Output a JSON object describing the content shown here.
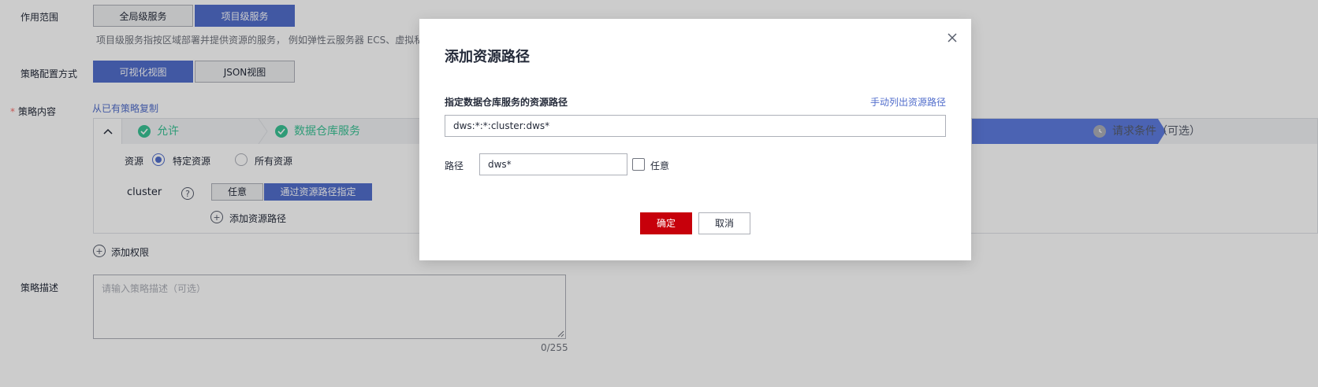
{
  "scope": {
    "label": "作用范围",
    "options": [
      "全局级服务",
      "项目级服务"
    ],
    "selected_index": 1,
    "hint": "项目级服务指按区域部署并提供资源的服务， 例如弹性云服务器 ECS、虚拟私"
  },
  "config_mode": {
    "label": "策略配置方式",
    "options": [
      "可视化视图",
      "JSON视图"
    ],
    "selected_index": 0
  },
  "policy_content": {
    "required_mark": "*",
    "label": "策略内容",
    "copy_link": "从已有策略复制",
    "steps": [
      {
        "label": "允许",
        "state": "done"
      },
      {
        "label": "数据仓库服务",
        "state": "done"
      },
      {
        "label": "请求条件（可选）",
        "state": "todo"
      }
    ],
    "resource": {
      "label": "资源",
      "options": [
        "特定资源",
        "所有资源"
      ],
      "selected_index": 0
    },
    "cluster": {
      "label": "cluster",
      "help_icon": "question-circle-icon",
      "options": [
        "任意",
        "通过资源路径指定"
      ],
      "selected_index": 1
    },
    "add_path_label": "添加资源路径"
  },
  "add_permission_label": "添加权限",
  "description": {
    "label": "策略描述",
    "placeholder": "请输入策略描述（可选）",
    "counter": "0/255"
  },
  "modal": {
    "title": "添加资源路径",
    "close_icon": "close-icon",
    "field_label": "指定数据仓库服务的资源路径",
    "manual_link": "手动列出资源路径",
    "path_value": "dws:*:*:cluster:dws*",
    "path_label": "路径",
    "path_input_value": "dws*",
    "any_label": "任意",
    "any_checked": false,
    "confirm_label": "确定",
    "cancel_label": "取消"
  },
  "colors": {
    "primary_blue": "#526ecc",
    "success_green": "#3ac295",
    "danger_red": "#c7000b"
  }
}
